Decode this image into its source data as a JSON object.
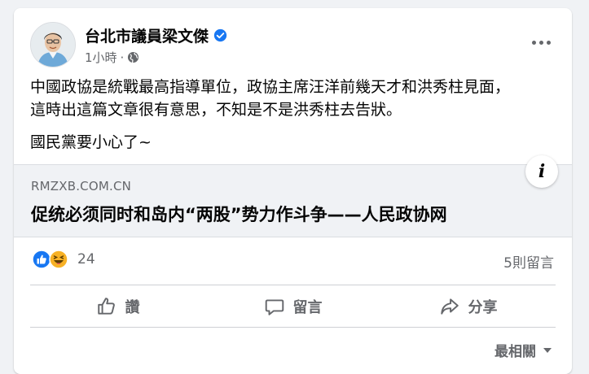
{
  "post": {
    "author": "台北市議員梁文傑",
    "time": "1小時",
    "separator": "·",
    "lines": [
      "中國政協是統戰最高指導單位，政協主席汪洋前幾天才和洪秀柱見面，",
      "這時出這篇文章很有意思，不知是不是洪秀柱去告狀。"
    ],
    "line3": "國民黨要小心了~"
  },
  "link_preview": {
    "domain": "RMZXB.COM.CN",
    "headline": "促统必须同时和岛内“两股”势力作斗争——人民政协网",
    "info_glyph": "i"
  },
  "stats": {
    "reaction_count": "24",
    "comments": "5則留言"
  },
  "actions": {
    "like": "讚",
    "comment": "留言",
    "share": "分享"
  },
  "sort": {
    "label": "最相關"
  },
  "colors": {
    "facebook_blue": "#1877f2",
    "haha_yellow": "#f7b125",
    "secondary_text": "#65676b"
  }
}
